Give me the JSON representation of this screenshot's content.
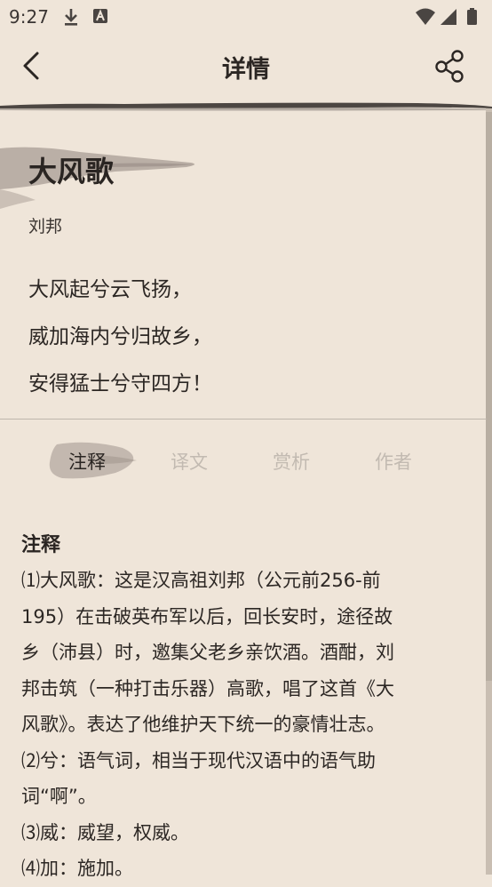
{
  "status_bar": {
    "time": "9:27",
    "left_icons": [
      "download-icon",
      "a-badge-icon"
    ],
    "right_icons": [
      "wifi-icon",
      "signal-icon",
      "battery-icon"
    ]
  },
  "app_bar": {
    "back_icon": "chevron-left-icon",
    "title": "详情",
    "share_icon": "share-icon"
  },
  "poem": {
    "title": "大风歌",
    "author": "刘邦",
    "lines": [
      "大风起兮云飞扬，",
      "威加海内兮归故乡，",
      "安得猛士兮守四方！"
    ]
  },
  "tabs": [
    {
      "label": "注释",
      "active": true
    },
    {
      "label": "译文",
      "active": false
    },
    {
      "label": "赏析",
      "active": false
    },
    {
      "label": "作者",
      "active": false
    }
  ],
  "content": {
    "heading": "注释",
    "lines": [
      "⑴大风歌：这是汉高祖刘邦（公元前256-前",
      "195）在击破英布军以后，回长安时，途径故",
      "乡（沛县）时，邀集父老乡亲饮酒。酒酣，刘",
      "邦击筑（一种打击乐器）高歌，唱了这首《大",
      "风歌》。表达了他维护天下统一的豪情壮志。",
      "⑵兮：语气词，相当于现代汉语中的语气助",
      "词“啊”。",
      "⑶威：威望，权威。",
      "⑷加：施加。"
    ]
  },
  "colors": {
    "background": "#efe5d9",
    "text": "#2a2522",
    "inactive_tab": "#c2bab1",
    "brush": "#a89c94"
  }
}
